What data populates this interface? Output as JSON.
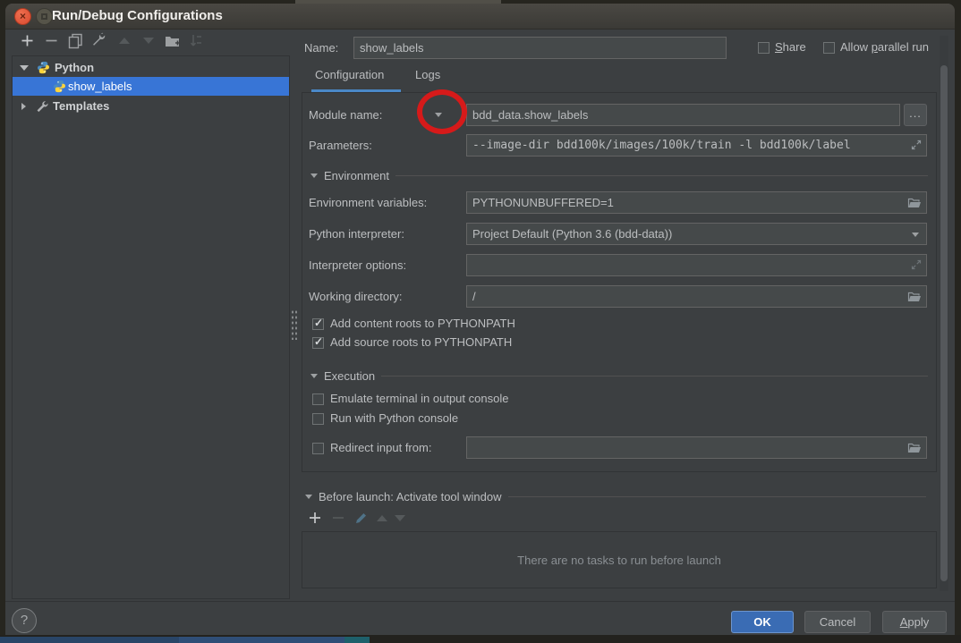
{
  "window": {
    "title": "Run/Debug Configurations"
  },
  "colors": {
    "selection_blue": "#3875d6",
    "tab_accent": "#4a88c7",
    "ok_blue": "#3a6cb4",
    "annotation_red": "#d61a1a"
  },
  "left_panel": {
    "toolbar": [
      "add",
      "remove",
      "copy",
      "edit-defaults",
      "move-up",
      "move-down",
      "new-folder",
      "sort-alphabetically"
    ],
    "tree": [
      {
        "label": "Python"
      },
      {
        "label": "show_labels"
      },
      {
        "label": "Templates"
      }
    ]
  },
  "header": {
    "name_label": "Name:",
    "name_value": "show_labels",
    "share": {
      "pre": "",
      "mnemonic": "S",
      "post": "hare"
    },
    "allow_parallel": {
      "pre": "Allow ",
      "mnemonic": "p",
      "post": "arallel run"
    }
  },
  "tabs": [
    {
      "label": "Configuration",
      "active": true
    },
    {
      "label": "Logs",
      "active": false
    }
  ],
  "form": {
    "module_name": {
      "label": "Module name:",
      "value": "bdd_data.show_labels",
      "browse": "..."
    },
    "parameters": {
      "label": "Parameters:",
      "value": "--image-dir bdd100k/images/100k/train -l bdd100k/label"
    },
    "environment_section": "Environment",
    "env_vars": {
      "label": "Environment variables:",
      "value": "PYTHONUNBUFFERED=1"
    },
    "interpreter": {
      "label": "Python interpreter:",
      "value": "Project Default (Python 3.6 (bdd-data))"
    },
    "interpreter_options": {
      "label": "Interpreter options:",
      "value": ""
    },
    "working_dir": {
      "label": "Working directory:",
      "value": "/"
    },
    "pythonpath": [
      {
        "label": "Add content roots to PYTHONPATH",
        "checked": true
      },
      {
        "label": "Add source roots to PYTHONPATH",
        "checked": true
      }
    ],
    "execution_section": "Execution",
    "exec_options": [
      {
        "label": "Emulate terminal in output console",
        "checked": false
      },
      {
        "label": "Run with Python console",
        "checked": false
      }
    ],
    "redirect": {
      "label": "Redirect input from:",
      "value": "",
      "checked": false
    }
  },
  "before_launch": {
    "title": "Before launch: Activate tool window",
    "toolbar": [
      "add",
      "remove",
      "edit",
      "move-up",
      "move-down"
    ],
    "empty_text": "There are no tasks to run before launch"
  },
  "footer": {
    "help": "?",
    "ok": "OK",
    "cancel": "Cancel",
    "apply": {
      "mnemonic": "A",
      "post": "pply"
    }
  },
  "chrome": {
    "close": "×"
  }
}
